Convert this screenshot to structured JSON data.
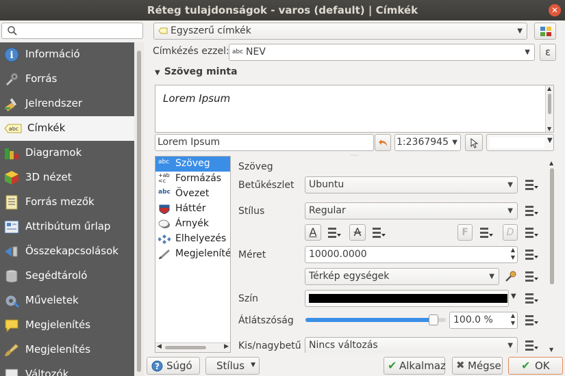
{
  "window": {
    "title": "Réteg tulajdonságok - varos (default) | Címkék"
  },
  "sidebar": {
    "search_placeholder": "",
    "items": [
      {
        "label": "Információ",
        "icon": "info-icon"
      },
      {
        "label": "Forrás",
        "icon": "settings-icon"
      },
      {
        "label": "Jelrendszer",
        "icon": "paintbrush-icon"
      },
      {
        "label": "Címkék",
        "icon": "labels-icon",
        "active": true
      },
      {
        "label": "Diagramok",
        "icon": "diagram-icon"
      },
      {
        "label": "3D nézet",
        "icon": "cube-icon"
      },
      {
        "label": "Forrás mezők",
        "icon": "fields-icon"
      },
      {
        "label": "Attribútum űrlap",
        "icon": "form-icon"
      },
      {
        "label": "Összekapcsolások",
        "icon": "join-icon"
      },
      {
        "label": "Segédtároló",
        "icon": "database-icon"
      },
      {
        "label": "Műveletek",
        "icon": "actions-icon"
      },
      {
        "label": "Megjelenítés",
        "icon": "speech-bubble-icon"
      },
      {
        "label": "Megjelenítés",
        "icon": "brush-icon"
      },
      {
        "label": "Változók",
        "icon": "variables-icon"
      }
    ]
  },
  "labels": {
    "mode": "Egyszerű címkék",
    "label_with_caption": "Címkézés ezzel:",
    "label_with_value": "NEV",
    "expression_symbol": "ε",
    "sample_heading": "Szöveg minta",
    "preview_text": "Lorem Ipsum",
    "sample_input": "Lorem Ipsum",
    "scale_value": "1:2367945"
  },
  "tabs": [
    {
      "label": "Szöveg",
      "icon": "text-icon",
      "active": true
    },
    {
      "label": "Formázás",
      "icon": "formatting-icon"
    },
    {
      "label": "Övezet",
      "icon": "buffer-icon"
    },
    {
      "label": "Háttér",
      "icon": "background-icon"
    },
    {
      "label": "Árnyék",
      "icon": "shadow-icon"
    },
    {
      "label": "Elhelyezés",
      "icon": "placement-icon"
    },
    {
      "label": "Megjelenítés",
      "icon": "rendering-icon"
    }
  ],
  "text_panel": {
    "heading": "Szöveg",
    "font_label": "Betűkészlet",
    "font_value": "Ubuntu",
    "style_label": "Stílus",
    "style_value": "Regular",
    "size_label": "Méret",
    "size_value": "10000.0000",
    "unit_value": "Térkép egységek",
    "color_label": "Szín",
    "color_value": "#000000",
    "opacity_label": "Átlátszóság",
    "opacity_value": "100.0 %",
    "opacity_fraction": 0.94,
    "case_label": "Kis/nagybetű",
    "case_value": "Nincs változás",
    "underline_letter": "A",
    "strike_letter": "A",
    "bold_letter": "F",
    "italic_letter": "D"
  },
  "buttons": {
    "help": "Súgó",
    "style": "Stílus",
    "apply": "Alkalmaz",
    "cancel": "Mégse",
    "ok": "OK"
  }
}
